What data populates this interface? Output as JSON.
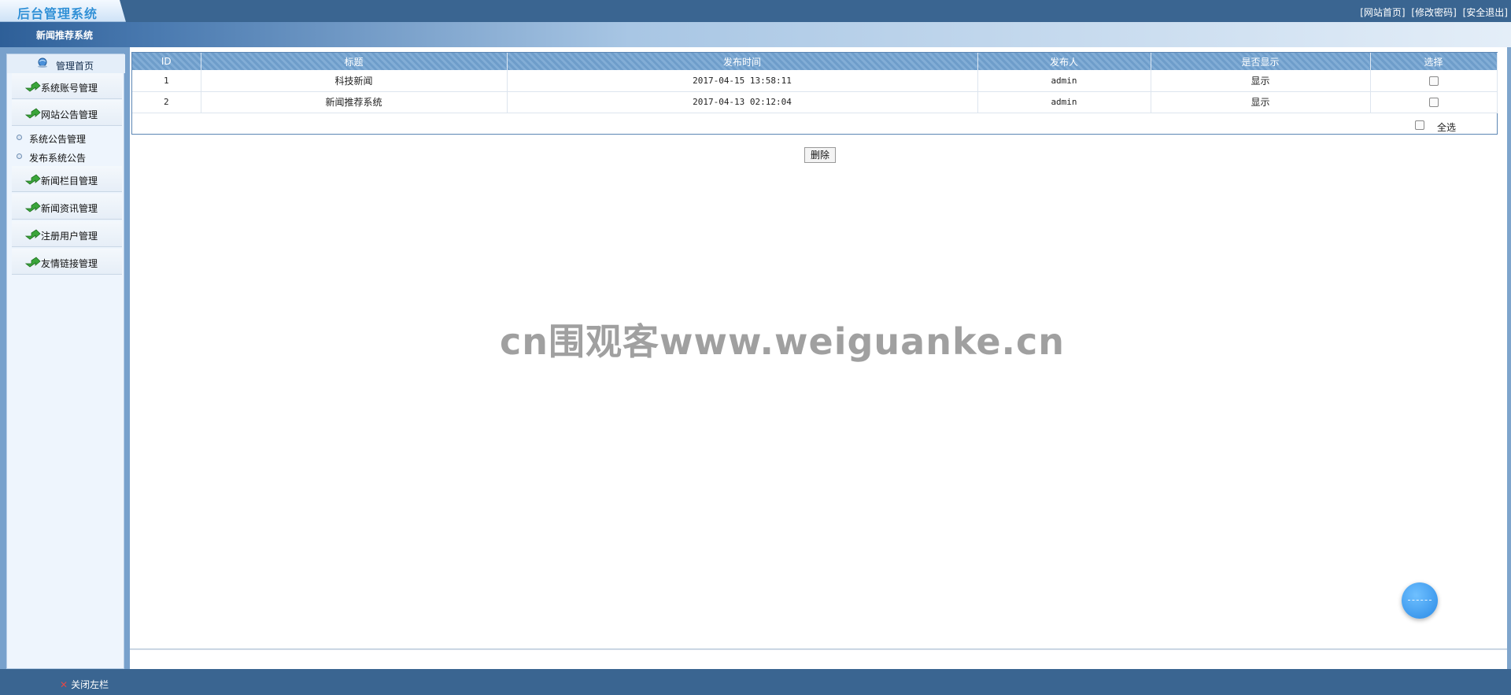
{
  "app": {
    "logo_text": "后台管理系统",
    "system_name": "新闻推荐系统"
  },
  "top_links": [
    "[网站首页]",
    "[修改密码]",
    "[安全退出]"
  ],
  "sidebar": {
    "home_label": "管理首页",
    "menu": [
      {
        "label": "系统账号管理"
      },
      {
        "label": "网站公告管理"
      },
      {
        "label": "新闻栏目管理"
      },
      {
        "label": "新闻资讯管理"
      },
      {
        "label": "注册用户管理"
      },
      {
        "label": "友情链接管理"
      }
    ],
    "sub_items": [
      {
        "label": "系统公告管理"
      },
      {
        "label": "发布系统公告"
      }
    ]
  },
  "table": {
    "columns": [
      "ID",
      "标题",
      "发布时间",
      "发布人",
      "是否显示",
      "选择"
    ],
    "rows": [
      {
        "id": "1",
        "title": "科技新闻",
        "time": "2017-04-15 13:58:11",
        "author": "admin",
        "show": "显示"
      },
      {
        "id": "2",
        "title": "新闻推荐系统",
        "time": "2017-04-13 02:12:04",
        "author": "admin",
        "show": "显示"
      }
    ],
    "select_all_label": "全选"
  },
  "actions": {
    "delete_label": "删除"
  },
  "watermark": "cn围观客www.weiguanke.cn",
  "footer": {
    "close_sidebar_label": "关闭左栏"
  }
}
